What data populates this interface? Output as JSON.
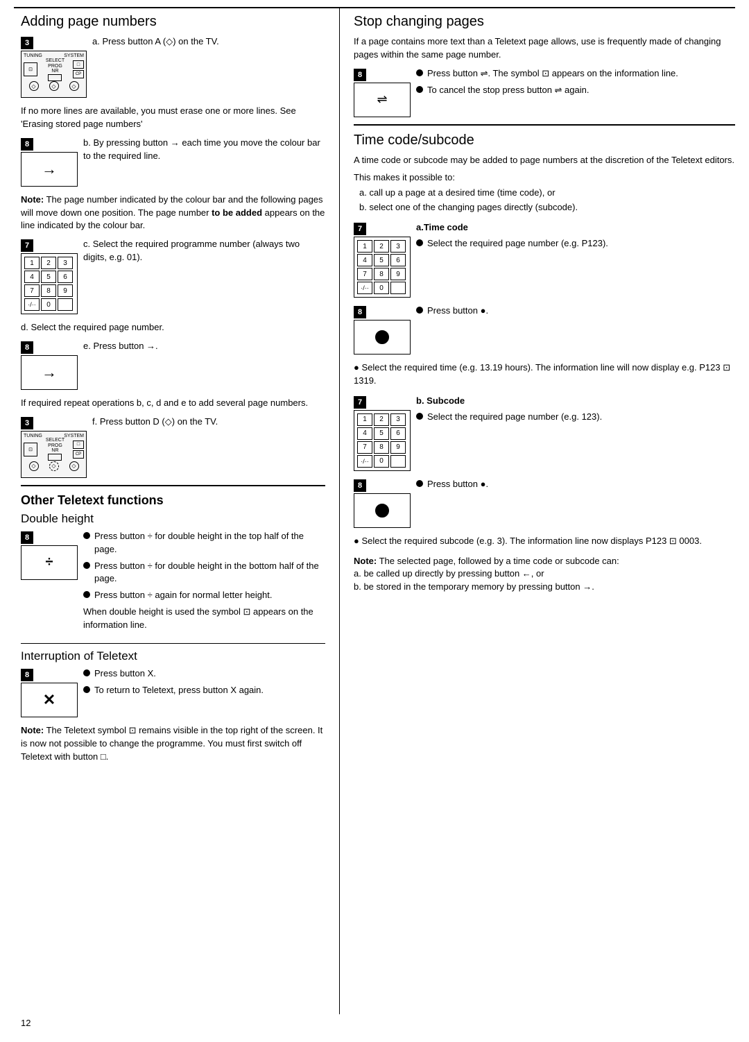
{
  "page": {
    "number": "12",
    "top_border": true
  },
  "left_column": {
    "section1": {
      "title": "Adding page numbers",
      "items": [
        {
          "id": "3a",
          "badge": "3",
          "has_tv": true,
          "text": "a. Press button A (◇) on the TV."
        },
        {
          "id": "note1",
          "text": "If no more lines are available, you must erase one or more lines. See 'Erasing stored page numbers'"
        },
        {
          "id": "8b",
          "badge": "8",
          "has_arrow": true,
          "text": "b. By pressing button → each time you move the colour bar to the required line."
        },
        {
          "id": "note2",
          "text": "Note: The page number indicated by the colour bar and the following pages will move down one position. The page number to be added appears on the line indicated by the colour bar."
        },
        {
          "id": "7c",
          "badge": "7",
          "has_keypad": true,
          "text": "c. Select the required programme number (always two digits, e.g. 01)."
        },
        {
          "id": "d",
          "text": "d. Select the required page number."
        },
        {
          "id": "8e",
          "badge": "8",
          "has_arrow": true,
          "text": "e. Press button →."
        },
        {
          "id": "note3",
          "text": "If required repeat operations b, c, d and e to add several page numbers."
        },
        {
          "id": "3f",
          "badge": "3",
          "has_tv": true,
          "text": "f. Press button D (◇) on the TV."
        }
      ]
    },
    "divider1": true,
    "section2": {
      "title": "Other Teletext functions",
      "subsections": [
        {
          "title": "Double height",
          "items": [
            {
              "id": "8dh",
              "badge": "8",
              "has_dh": true,
              "bullets": [
                "Press button ÷ for double height in the top half of the page.",
                "Press button ÷ for double height in the bottom half of the page.",
                "Press button ÷ again for normal letter height."
              ],
              "note": "When double height is used the symbol ⊡ appears on the information line."
            }
          ]
        },
        {
          "title": "Interruption of Teletext",
          "items": [
            {
              "id": "8x",
              "badge": "8",
              "has_x": true,
              "bullets": [
                "Press button X.",
                "To return to Teletext, press button X again."
              ],
              "note": "Note: The Teletext symbol ⊡ remains visible in the top right of the screen. It is now not possible to change the programme. You must first switch off Teletext with button □."
            }
          ]
        }
      ]
    }
  },
  "right_column": {
    "section1": {
      "title": "Stop changing pages",
      "paragraphs": [
        "If a page contains more text than a Teletext page allows, use is frequently made of changing pages within the same page number.",
        "Press button ⇌. The symbol ⊡ appears on the information line.",
        "To cancel the stop press button ⇌ again."
      ]
    },
    "section2": {
      "title": "Time code/subcode",
      "intro": [
        "A time code or subcode may be added to page numbers at the discretion of the Teletext editors.",
        "This makes it possible to:",
        "a. call up a page at a desired time (time code), or",
        "b. select one of the changing pages directly (subcode)."
      ],
      "subsections": [
        {
          "title": "a.Time code",
          "badge": "7",
          "has_keypad": true,
          "bullets": [
            "Select the required page number (e.g. P123)."
          ]
        },
        {
          "title_2": "",
          "badge": "8",
          "has_circle": true,
          "bullets": [
            "Press button ●."
          ],
          "note": "Select the required time (e.g. 13.19 hours). The information line will now display e.g. P123 ⊡ 1319."
        },
        {
          "title": "b. Subcode",
          "badge": "7",
          "has_keypad": true,
          "bullets": [
            "Select the required page number (e.g. 123)."
          ]
        },
        {
          "title_2": "",
          "badge": "8",
          "has_circle": true,
          "bullets": [
            "Press button ●."
          ],
          "note": "Select the required subcode (e.g. 3). The information line now displays P123 ⊡ 0003."
        }
      ],
      "final_note": "Note: The selected page, followed by a time code or subcode can:\na. be called up directly by pressing button ←, or\nb. be stored in the temporary memory by pressing button →."
    }
  }
}
